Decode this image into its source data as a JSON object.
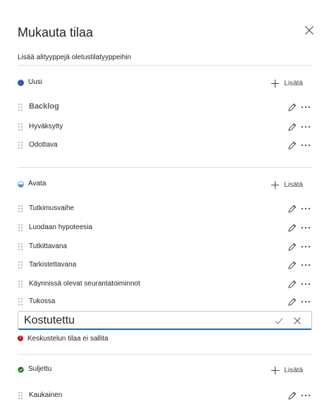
{
  "panel": {
    "title": "Mukauta tilaa",
    "subtitle": "Lisää alityyppejä oletustilatyyppeihin",
    "close_icon": "close-icon"
  },
  "colors": {
    "uusi": "#2f5ea6",
    "avata": "#4a90c8",
    "suljettu": "#107c10",
    "error": "#c50f1f",
    "accent": "#0f6cbd"
  },
  "groups": {
    "uusi": {
      "name": "Uusi",
      "add_label": "Lisätä",
      "items": [
        "Backlog",
        "Hyväksytty",
        "Odottava"
      ]
    },
    "avata": {
      "name": "Avata",
      "add_label": "Lisätä",
      "items": [
        "Tutkimusvaihe",
        "Luodaan hypoteesia",
        "Tutkittavana",
        "Tarkistettavana",
        "Käynnissä olevat seurantatoiminnot",
        "Tukossa"
      ]
    },
    "suljettu": {
      "name": "Suljettu",
      "add_label": "Lisätä",
      "items": [
        "Kaukainen"
      ]
    }
  },
  "editor": {
    "value": "Kostutettu",
    "error": "Keskustelun tilaa ei sallita"
  }
}
